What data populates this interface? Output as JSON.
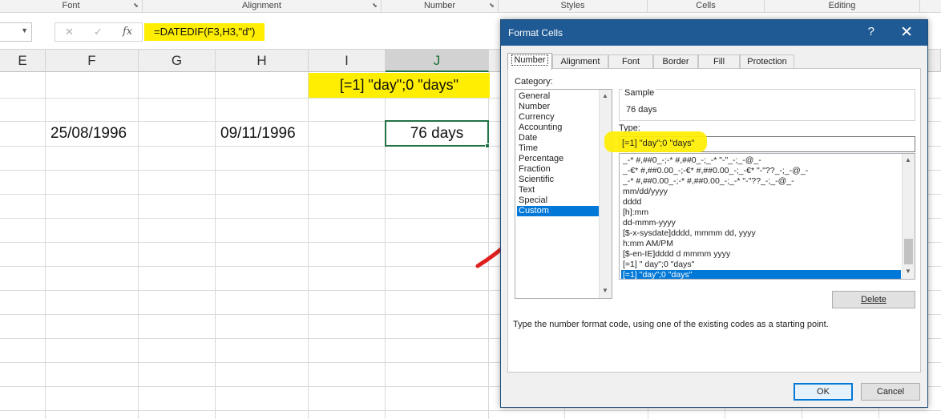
{
  "ribbon": {
    "groups": [
      {
        "label": "Font"
      },
      {
        "label": "Alignment"
      },
      {
        "label": "Number"
      },
      {
        "label": "Styles"
      },
      {
        "label": "Cells"
      },
      {
        "label": "Editing"
      }
    ]
  },
  "formula_bar": {
    "cancel_icon": "✕",
    "enter_icon": "✓",
    "fx_label": "fx",
    "formula": "=DATEDIF(F3,H3,\"d\")"
  },
  "grid": {
    "columns": [
      "E",
      "F",
      "G",
      "H",
      "I",
      "J"
    ],
    "selected_column": "J",
    "cells": {
      "i1": "[=1] \"day\";0 \"days\"",
      "f3": "25/08/1996",
      "h3": "09/11/1996",
      "j3": "76 days"
    }
  },
  "dialog": {
    "title": "Format Cells",
    "help_label": "?",
    "close_label": "✕",
    "tabs": [
      {
        "label": "Number",
        "active": true
      },
      {
        "label": "Alignment",
        "active": false
      },
      {
        "label": "Font",
        "active": false
      },
      {
        "label": "Border",
        "active": false
      },
      {
        "label": "Fill",
        "active": false
      },
      {
        "label": "Protection",
        "active": false
      }
    ],
    "category_label": "Category:",
    "categories": [
      "General",
      "Number",
      "Currency",
      "Accounting",
      "Date",
      "Time",
      "Percentage",
      "Fraction",
      "Scientific",
      "Text",
      "Special",
      "Custom"
    ],
    "selected_category": "Custom",
    "sample_label": "Sample",
    "sample_value": "76 days",
    "type_label": "Type:",
    "type_value": "[=1] \"day\";0 \"days\"",
    "formats": [
      "_-* #,##0_-;-* #,##0_-;_-* \"-\"_-;_-@_-",
      "_-€* #,##0.00_-;-€* #,##0.00_-;_-€* \"-\"??_-;_-@_-",
      "_-* #,##0.00_-;-* #,##0.00_-;_-* \"-\"??_-;_-@_-",
      "mm/dd/yyyy",
      "dddd",
      "[h]:mm",
      "dd-mmm-yyyy",
      "[$-x-sysdate]dddd, mmmm dd, yyyy",
      "h:mm AM/PM",
      "[$-en-IE]dddd d mmmm yyyy",
      "[=1] \" day\";0 \"days\"",
      "[=1] \"day\";0 \"days\""
    ],
    "selected_format_index": 11,
    "delete_label": "Delete",
    "hint": "Type the number format code, using one of the existing codes as a starting point.",
    "ok_label": "OK",
    "cancel_label": "Cancel"
  },
  "colors": {
    "highlight": "#ffee00",
    "excel_green": "#217346",
    "title_bar": "#1f5a94",
    "selection": "#0078d7",
    "arrow": "#e02020"
  }
}
